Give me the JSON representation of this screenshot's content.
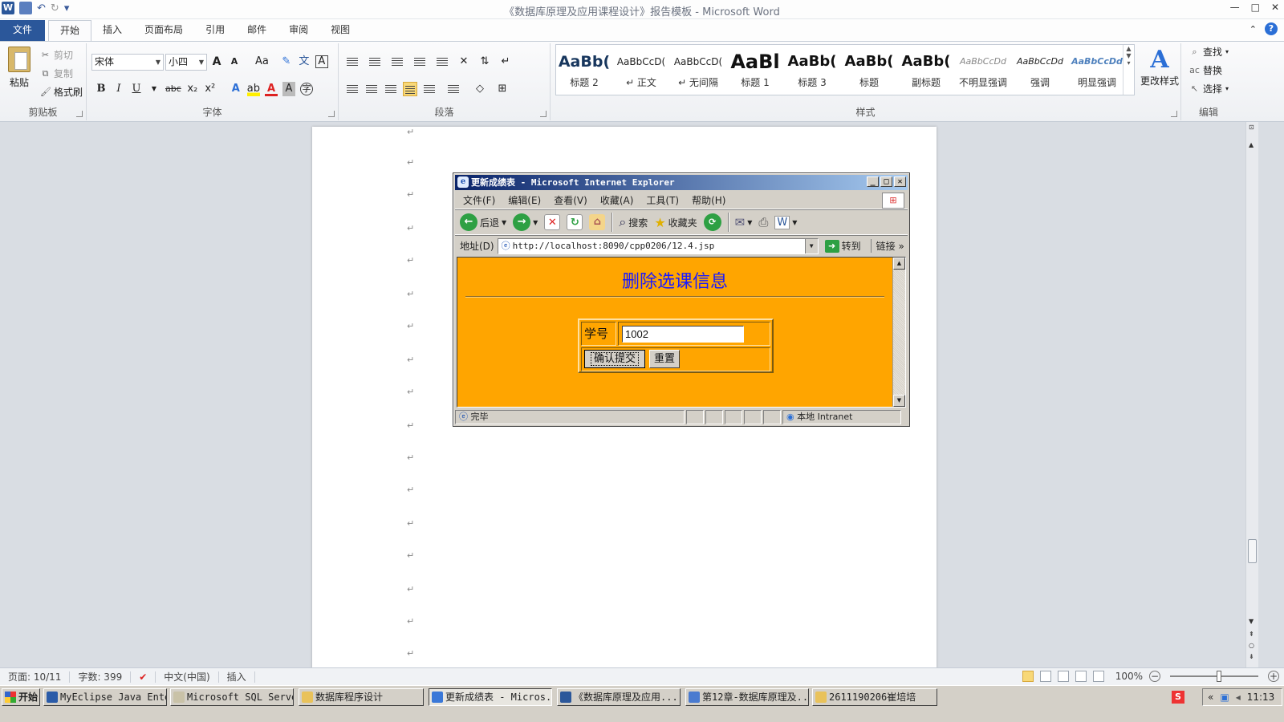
{
  "window": {
    "title": "《数据库原理及应用课程设计》报告模板 - Microsoft Word",
    "app_logo": "W",
    "controls": [
      "—",
      "□",
      "✕"
    ]
  },
  "quick_access": {
    "undo": "↶",
    "redo": "↻",
    "menu": "▾"
  },
  "ribbon_tabs": [
    "文件",
    "开始",
    "插入",
    "页面布局",
    "引用",
    "邮件",
    "审阅",
    "视图"
  ],
  "clipboard": {
    "label": "剪贴板",
    "paste": "粘贴",
    "cut": "剪切",
    "copy": "复制",
    "format_painter": "格式刷"
  },
  "font": {
    "label": "字体",
    "family": "宋体",
    "size": "小四",
    "grow": "A",
    "shrink": "A",
    "change_case": "Aa",
    "bold": "B",
    "italic": "I",
    "underline": "U",
    "strike": "abc",
    "subscript": "x₂",
    "superscript": "x²"
  },
  "paragraph": {
    "label": "段落"
  },
  "styles": {
    "label": "样式",
    "items": [
      {
        "sample": "AaBb(",
        "name": "标题 2"
      },
      {
        "sample": "AaBbCcD(",
        "name": "↵ 正文"
      },
      {
        "sample": "AaBbCcD(",
        "name": "↵ 无间隔"
      },
      {
        "sample": "AaBl",
        "name": "标题 1"
      },
      {
        "sample": "AaBb(",
        "name": "标题 3"
      },
      {
        "sample": "AaBb(",
        "name": "标题"
      },
      {
        "sample": "AaBb(",
        "name": "副标题"
      },
      {
        "sample": "AaBbCcDd",
        "name": "不明显强调"
      },
      {
        "sample": "AaBbCcDd",
        "name": "强调"
      },
      {
        "sample": "AaBbCcDd",
        "name": "明显强调"
      }
    ],
    "change_styles": "更改样式"
  },
  "editing": {
    "label": "编辑",
    "find": "查找",
    "replace": "替换",
    "select": "选择"
  },
  "document": {
    "paragraph_mark": "↵"
  },
  "ie": {
    "title": "更新成绩表 - Microsoft Internet Explorer",
    "menu": [
      "文件(F)",
      "编辑(E)",
      "查看(V)",
      "收藏(A)",
      "工具(T)",
      "帮助(H)"
    ],
    "toolbar": {
      "back": "后退",
      "search": "搜索",
      "favorites": "收藏夹"
    },
    "address_label": "地址(D)",
    "url": "http://localhost:8090/cpp0206/12.4.jsp",
    "go": "转到",
    "links": "链接",
    "page": {
      "heading": "删除选课信息",
      "field_label": "学号",
      "field_value": "1002",
      "submit": "确认提交",
      "reset": "重置",
      "background": "#ffa500",
      "heading_color": "#1a1aff"
    },
    "status": {
      "text": "完毕",
      "zone": "本地 Intranet"
    }
  },
  "statusbar": {
    "page": "页面: 10/11",
    "words": "字数: 399",
    "language": "中文(中国)",
    "mode": "插入",
    "zoom": "100%"
  },
  "taskbar": {
    "start": "开始",
    "tasks": [
      "MyEclipse Java Ente...",
      "Microsoft SQL Serve...",
      "数据库程序设计",
      "更新成绩表 - Micros...",
      "《数据库原理及应用...",
      "第12章-数据库原理及...",
      "2611190206崔培培"
    ],
    "active_task": 3,
    "ime": "S",
    "clock": "11:13"
  },
  "colors": {
    "word_blue": "#2b579a",
    "ie_orange": "#ffa500"
  }
}
